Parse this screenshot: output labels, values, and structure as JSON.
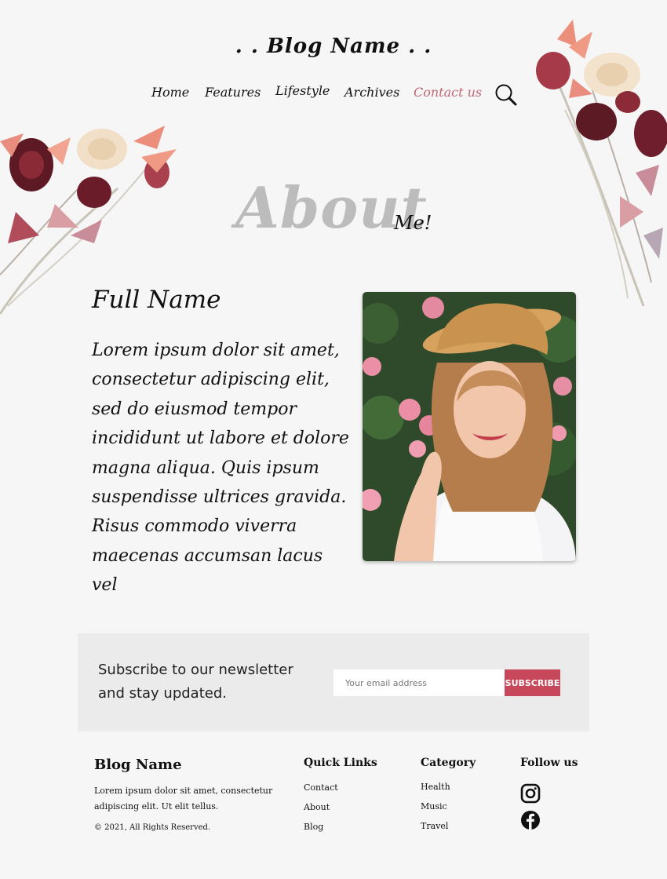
{
  "header": {
    "blog_name": ". .  Blog Name  . ."
  },
  "nav": {
    "items": [
      {
        "label": "Home",
        "active": false
      },
      {
        "label": "Features",
        "active": false
      },
      {
        "label": "Lifestyle",
        "active": false
      },
      {
        "label": "Archives",
        "active": false
      },
      {
        "label": "Contact us",
        "active": true
      }
    ],
    "search_icon": "search-icon"
  },
  "about": {
    "big": "About",
    "small": "Me!",
    "full_name": "Full Name",
    "lorem_lines": [
      "Lorem ipsum dolor sit amet,",
      "consectetur adipiscing elit,",
      "sed do eiusmod tempor",
      "incididunt ut labore et dolore",
      "magna aliqua. Quis ipsum",
      "suspendisse ultrices gravida.",
      "Risus commodo viverra",
      "maecenas accumsan lacus vel"
    ]
  },
  "newsletter": {
    "text": "Subscribe to our newsletter and stay updated.",
    "placeholder": "Your email address",
    "button": "SUBSCRIBE"
  },
  "footer": {
    "brand": "Blog Name",
    "desc": "Lorem ipsum dolor sit amet, consectetur adipiscing elit. Ut elit tellus.",
    "copyright": "© 2021, All Rights Reserved.",
    "quick_links": {
      "title": "Quick Links",
      "items": [
        "Contact",
        "About",
        "Blog"
      ]
    },
    "category": {
      "title": "Category",
      "items": [
        "Health",
        "Music",
        "Travel"
      ]
    },
    "follow": {
      "title": "Follow us",
      "icons": [
        "instagram-icon",
        "facebook-icon"
      ]
    }
  },
  "colors": {
    "accent": "#c8485b",
    "nav_active": "#c06674",
    "background": "#f6f6f6",
    "newsletter_bg": "#ebebeb"
  }
}
